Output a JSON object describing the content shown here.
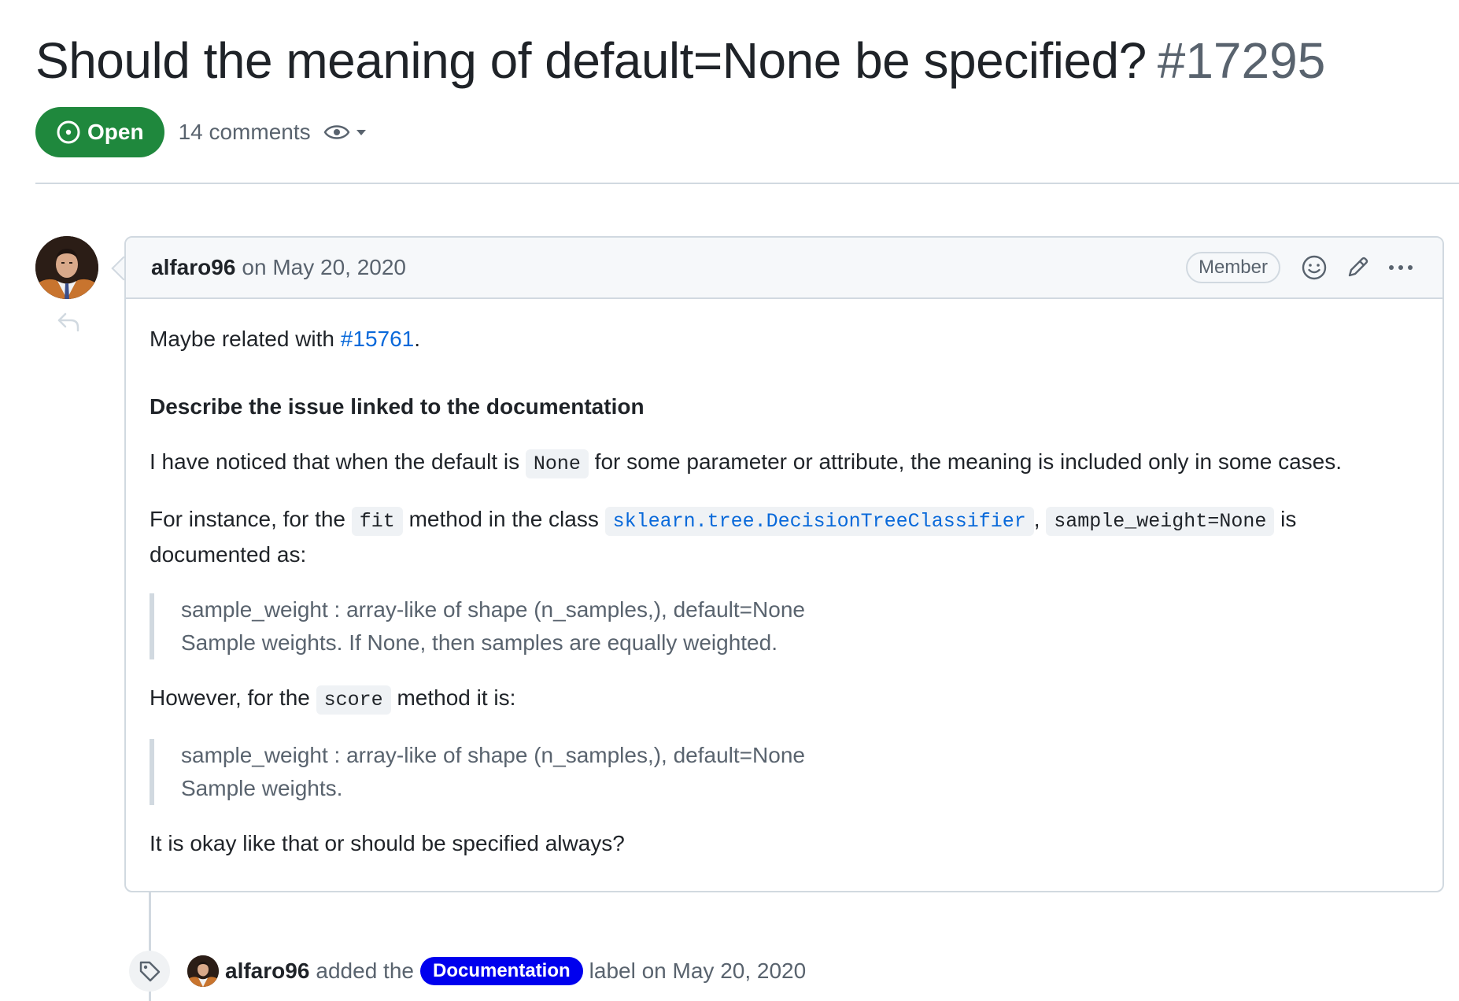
{
  "issue": {
    "title": "Should the meaning of default=None be specified?",
    "number": "#17295",
    "state": "Open",
    "comments_count": "14 comments"
  },
  "comment": {
    "author": "alfaro96",
    "date": "on May 20, 2020",
    "role_badge": "Member",
    "body": {
      "p1_prefix": "Maybe related with ",
      "p1_link": "#15761",
      "p1_suffix": ".",
      "heading": "Describe the issue linked to the documentation",
      "p2_prefix": "I have noticed that when the default is ",
      "p2_code": "None",
      "p2_suffix": " for some parameter or attribute, the meaning is included only in some cases.",
      "p3_prefix": "For instance, for the ",
      "p3_code_fit": "fit",
      "p3_mid": " method in the class ",
      "p3_code_class": "sklearn.tree.DecisionTreeClassifier",
      "p3_comma": ",",
      "p3_code_param": "sample_weight=None",
      "p3_suffix": " is documented as:",
      "quote1_line1": "sample_weight : array-like of shape (n_samples,), default=None",
      "quote1_line2": "Sample weights. If None, then samples are equally weighted.",
      "p4_prefix": "However, for the ",
      "p4_code": "score",
      "p4_suffix": " method it is:",
      "quote2_line1": "sample_weight : array-like of shape (n_samples,), default=None",
      "quote2_line2": "Sample weights.",
      "p5": "It is okay like that or should be specified always?"
    }
  },
  "event": {
    "author": "alfaro96",
    "text_before": "added the",
    "label": "Documentation",
    "text_after": "label on May 20, 2020",
    "label_color": "#0000ee"
  },
  "colors": {
    "open_green": "#1f883d",
    "link_blue": "#0969da",
    "muted": "#59636e",
    "border": "#d1d9e0"
  },
  "icons": {
    "state": "issue-opened-icon",
    "watch": "eye-icon",
    "watch_dropdown": "triangle-down-icon",
    "reply": "reply-icon",
    "reaction": "smiley-icon",
    "edit": "pencil-icon",
    "more": "kebab-horizontal-icon",
    "event": "tag-icon"
  }
}
